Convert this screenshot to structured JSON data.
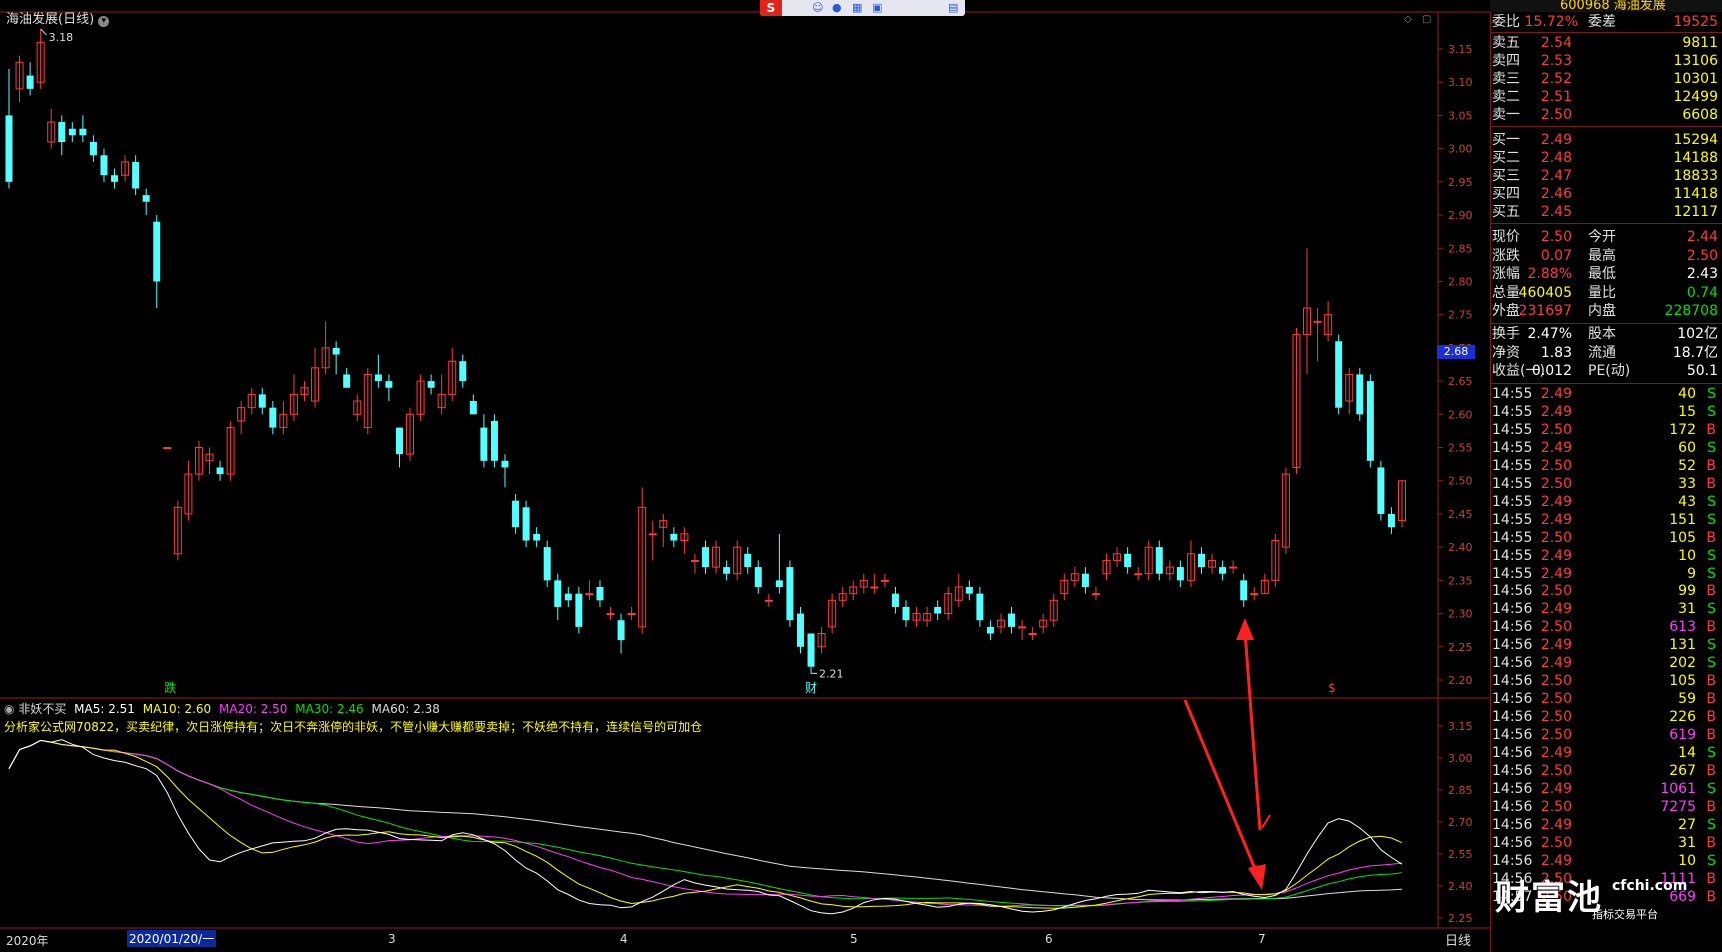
{
  "stock": {
    "title": "海油发展(日线)",
    "code": "600968",
    "name": "海油发展",
    "current_price_tag": "2.68",
    "period_button": "日线"
  },
  "indicator": {
    "name": "非妖不买",
    "ma5": "MA5: 2.51",
    "ma10": "MA10: 2.60",
    "ma20": "MA20: 2.50",
    "ma30": "MA30: 2.46",
    "ma60": "MA60: 2.38",
    "note": "分析家公式网70822，买卖纪律，次日涨停持有；次日不奔涨停的非妖，不管小赚大赚都要卖掉；不妖绝不持有，连续信号的可加仓"
  },
  "markers": {
    "high": "3.18",
    "low": "2.21",
    "tag_die": "跌",
    "tag_cai": "财",
    "tag_dollar": "$"
  },
  "x_axis": {
    "year": "2020年",
    "selected_date": "2020/01/20/一",
    "months": [
      "3",
      "4",
      "5",
      "6",
      "7"
    ]
  },
  "price_axis": [
    "3.15",
    "3.10",
    "3.05",
    "3.00",
    "2.95",
    "2.90",
    "2.85",
    "2.80",
    "2.75",
    "2.70",
    "2.65",
    "2.60",
    "2.55",
    "2.50",
    "2.45",
    "2.40",
    "2.35",
    "2.30",
    "2.25",
    "2.20"
  ],
  "indicator_axis": [
    "3.15",
    "3.00",
    "2.85",
    "2.70",
    "2.55",
    "2.40",
    "2.25"
  ],
  "order_book": {
    "weibi": {
      "label": "委比",
      "value": "15.72%",
      "label2": "委差",
      "value2": "19525"
    },
    "asks": [
      {
        "label": "卖五",
        "price": "2.54",
        "vol": "9811"
      },
      {
        "label": "卖四",
        "price": "2.53",
        "vol": "13106"
      },
      {
        "label": "卖三",
        "price": "2.52",
        "vol": "10301"
      },
      {
        "label": "卖二",
        "price": "2.51",
        "vol": "12499"
      },
      {
        "label": "卖一",
        "price": "2.50",
        "vol": "6608"
      }
    ],
    "bids": [
      {
        "label": "买一",
        "price": "2.49",
        "vol": "15294"
      },
      {
        "label": "买二",
        "price": "2.48",
        "vol": "14188"
      },
      {
        "label": "买三",
        "price": "2.47",
        "vol": "18833"
      },
      {
        "label": "买四",
        "price": "2.46",
        "vol": "11418"
      },
      {
        "label": "买五",
        "price": "2.45",
        "vol": "12117"
      }
    ]
  },
  "quote": [
    {
      "l1": "现价",
      "v1": "2.50",
      "l2": "今开",
      "v2": "2.44"
    },
    {
      "l1": "涨跌",
      "v1": "0.07",
      "l2": "最高",
      "v2": "2.50"
    },
    {
      "l1": "涨幅",
      "v1": "2.88%",
      "l2": "最低",
      "v2": "2.43"
    },
    {
      "l1": "总量",
      "v1": "460405",
      "l2": "量比",
      "v2": "0.74"
    },
    {
      "l1": "外盘",
      "v1": "231697",
      "l2": "内盘",
      "v2": "228708"
    }
  ],
  "fundamentals": [
    {
      "l1": "换手",
      "v1": "2.47%",
      "l2": "股本",
      "v2": "102亿"
    },
    {
      "l1": "净资",
      "v1": "1.83",
      "l2": "流通",
      "v2": "18.7亿"
    },
    {
      "l1": "收益(一)",
      "v1": "0.012",
      "l2": "PE(动)",
      "v2": "50.1"
    }
  ],
  "ticks": [
    {
      "t": "14:55",
      "p": "2.49",
      "v": "40",
      "s": "S"
    },
    {
      "t": "14:55",
      "p": "2.49",
      "v": "15",
      "s": "S"
    },
    {
      "t": "14:55",
      "p": "2.50",
      "v": "172",
      "s": "B"
    },
    {
      "t": "14:55",
      "p": "2.49",
      "v": "60",
      "s": "S"
    },
    {
      "t": "14:55",
      "p": "2.50",
      "v": "52",
      "s": "B"
    },
    {
      "t": "14:55",
      "p": "2.50",
      "v": "33",
      "s": "B"
    },
    {
      "t": "14:55",
      "p": "2.49",
      "v": "43",
      "s": "S"
    },
    {
      "t": "14:55",
      "p": "2.49",
      "v": "151",
      "s": "S"
    },
    {
      "t": "14:55",
      "p": "2.50",
      "v": "105",
      "s": "B"
    },
    {
      "t": "14:55",
      "p": "2.49",
      "v": "10",
      "s": "S"
    },
    {
      "t": "14:55",
      "p": "2.49",
      "v": "9",
      "s": "S"
    },
    {
      "t": "14:56",
      "p": "2.50",
      "v": "99",
      "s": "B"
    },
    {
      "t": "14:56",
      "p": "2.49",
      "v": "31",
      "s": "S"
    },
    {
      "t": "14:56",
      "p": "2.50",
      "v": "613",
      "s": "B"
    },
    {
      "t": "14:56",
      "p": "2.49",
      "v": "131",
      "s": "S"
    },
    {
      "t": "14:56",
      "p": "2.49",
      "v": "202",
      "s": "S"
    },
    {
      "t": "14:56",
      "p": "2.50",
      "v": "105",
      "s": "B"
    },
    {
      "t": "14:56",
      "p": "2.50",
      "v": "59",
      "s": "B"
    },
    {
      "t": "14:56",
      "p": "2.50",
      "v": "226",
      "s": "B"
    },
    {
      "t": "14:56",
      "p": "2.50",
      "v": "619",
      "s": "B"
    },
    {
      "t": "14:56",
      "p": "2.49",
      "v": "14",
      "s": "S"
    },
    {
      "t": "14:56",
      "p": "2.50",
      "v": "267",
      "s": "B"
    },
    {
      "t": "14:56",
      "p": "2.49",
      "v": "1061",
      "s": "S"
    },
    {
      "t": "14:56",
      "p": "2.50",
      "v": "7275",
      "s": "B"
    },
    {
      "t": "14:56",
      "p": "2.49",
      "v": "27",
      "s": "S"
    },
    {
      "t": "14:56",
      "p": "2.50",
      "v": "31",
      "s": "B"
    },
    {
      "t": "14:56",
      "p": "2.49",
      "v": "10",
      "s": "S"
    },
    {
      "t": "14:56",
      "p": "2.50",
      "v": "1111",
      "s": "B"
    },
    {
      "t": "14:57",
      "p": "2.50",
      "v": "669",
      "s": "B"
    }
  ],
  "watermark": {
    "main": "财富池",
    "site": "cfchi.com",
    "sub": "指标交易平台"
  },
  "colors": {
    "up": "#ff3b3b",
    "down": "#54ffff",
    "ma5": "#ffffff",
    "ma10": "#ffff00",
    "ma20": "#ff3cff",
    "ma30": "#00e400",
    "ma60": "#dddddd",
    "arrow": "#ff2020"
  },
  "candles": [
    [
      3.05,
      2.95,
      3.12,
      2.94
    ],
    [
      3.09,
      3.13,
      3.14,
      3.07
    ],
    [
      3.11,
      3.09,
      3.13,
      3.08
    ],
    [
      3.1,
      3.16,
      3.18,
      3.09
    ],
    [
      3.01,
      3.04,
      3.06,
      3.0
    ],
    [
      3.04,
      3.01,
      3.05,
      2.99
    ],
    [
      3.03,
      3.02,
      3.04,
      3.01
    ],
    [
      3.03,
      3.02,
      3.05,
      3.01
    ],
    [
      3.01,
      2.99,
      3.02,
      2.98
    ],
    [
      2.99,
      2.96,
      3.0,
      2.95
    ],
    [
      2.96,
      2.95,
      2.97,
      2.94
    ],
    [
      2.96,
      2.98,
      2.99,
      2.95
    ],
    [
      2.98,
      2.94,
      2.99,
      2.93
    ],
    [
      2.93,
      2.92,
      2.94,
      2.9
    ],
    [
      2.89,
      2.8,
      2.9,
      2.76
    ],
    [
      2.55,
      2.55,
      2.55,
      2.55
    ],
    [
      2.39,
      2.46,
      2.47,
      2.38
    ],
    [
      2.45,
      2.51,
      2.53,
      2.44
    ],
    [
      2.51,
      2.55,
      2.56,
      2.5
    ],
    [
      2.53,
      2.54,
      2.55,
      2.51
    ],
    [
      2.52,
      2.51,
      2.53,
      2.5
    ],
    [
      2.51,
      2.58,
      2.59,
      2.5
    ],
    [
      2.59,
      2.61,
      2.62,
      2.57
    ],
    [
      2.61,
      2.63,
      2.64,
      2.6
    ],
    [
      2.63,
      2.61,
      2.64,
      2.6
    ],
    [
      2.61,
      2.58,
      2.62,
      2.57
    ],
    [
      2.58,
      2.6,
      2.62,
      2.57
    ],
    [
      2.6,
      2.63,
      2.66,
      2.59
    ],
    [
      2.63,
      2.64,
      2.65,
      2.62
    ],
    [
      2.62,
      2.67,
      2.7,
      2.61
    ],
    [
      2.67,
      2.7,
      2.74,
      2.66
    ],
    [
      2.7,
      2.69,
      2.71,
      2.66
    ],
    [
      2.66,
      2.64,
      2.67,
      2.64
    ],
    [
      2.6,
      2.62,
      2.63,
      2.59
    ],
    [
      2.58,
      2.66,
      2.67,
      2.57
    ],
    [
      2.66,
      2.65,
      2.69,
      2.64
    ],
    [
      2.65,
      2.64,
      2.66,
      2.62
    ],
    [
      2.58,
      2.54,
      2.58,
      2.52
    ],
    [
      2.54,
      2.6,
      2.61,
      2.53
    ],
    [
      2.6,
      2.65,
      2.66,
      2.59
    ],
    [
      2.65,
      2.64,
      2.66,
      2.63
    ],
    [
      2.61,
      2.63,
      2.66,
      2.6
    ],
    [
      2.63,
      2.68,
      2.7,
      2.62
    ],
    [
      2.68,
      2.65,
      2.69,
      2.64
    ],
    [
      2.62,
      2.6,
      2.63,
      2.6
    ],
    [
      2.58,
      2.53,
      2.6,
      2.52
    ],
    [
      2.59,
      2.53,
      2.6,
      2.52
    ],
    [
      2.53,
      2.52,
      2.54,
      2.49
    ],
    [
      2.47,
      2.43,
      2.48,
      2.42
    ],
    [
      2.46,
      2.41,
      2.47,
      2.4
    ],
    [
      2.42,
      2.41,
      2.43,
      2.4
    ],
    [
      2.4,
      2.35,
      2.41,
      2.34
    ],
    [
      2.35,
      2.31,
      2.36,
      2.29
    ],
    [
      2.33,
      2.32,
      2.34,
      2.31
    ],
    [
      2.33,
      2.28,
      2.34,
      2.27
    ],
    [
      2.33,
      2.33,
      2.35,
      2.32
    ],
    [
      2.34,
      2.32,
      2.35,
      2.31
    ],
    [
      2.3,
      2.3,
      2.31,
      2.29
    ],
    [
      2.29,
      2.26,
      2.3,
      2.24
    ],
    [
      2.3,
      2.3,
      2.31,
      2.29
    ],
    [
      2.28,
      2.46,
      2.49,
      2.27
    ],
    [
      2.42,
      2.42,
      2.44,
      2.38
    ],
    [
      2.43,
      2.44,
      2.45,
      2.4
    ],
    [
      2.42,
      2.41,
      2.43,
      2.4
    ],
    [
      2.41,
      2.42,
      2.43,
      2.39
    ],
    [
      2.38,
      2.38,
      2.39,
      2.36
    ],
    [
      2.4,
      2.37,
      2.41,
      2.36
    ],
    [
      2.37,
      2.4,
      2.41,
      2.36
    ],
    [
      2.37,
      2.36,
      2.38,
      2.35
    ],
    [
      2.36,
      2.4,
      2.41,
      2.35
    ],
    [
      2.39,
      2.37,
      2.4,
      2.36
    ],
    [
      2.37,
      2.34,
      2.38,
      2.33
    ],
    [
      2.32,
      2.32,
      2.33,
      2.31
    ],
    [
      2.35,
      2.34,
      2.42,
      2.33
    ],
    [
      2.37,
      2.29,
      2.38,
      2.28
    ],
    [
      2.3,
      2.25,
      2.31,
      2.24
    ],
    [
      2.27,
      2.22,
      2.27,
      2.21
    ],
    [
      2.25,
      2.27,
      2.28,
      2.24
    ],
    [
      2.28,
      2.32,
      2.33,
      2.27
    ],
    [
      2.32,
      2.33,
      2.34,
      2.31
    ],
    [
      2.33,
      2.34,
      2.35,
      2.32
    ],
    [
      2.34,
      2.35,
      2.36,
      2.33
    ],
    [
      2.34,
      2.34,
      2.36,
      2.33
    ],
    [
      2.35,
      2.35,
      2.36,
      2.34
    ],
    [
      2.33,
      2.31,
      2.34,
      2.3
    ],
    [
      2.31,
      2.29,
      2.32,
      2.28
    ],
    [
      2.29,
      2.3,
      2.31,
      2.28
    ],
    [
      2.29,
      2.3,
      2.31,
      2.28
    ],
    [
      2.31,
      2.3,
      2.32,
      2.29
    ],
    [
      2.3,
      2.33,
      2.34,
      2.29
    ],
    [
      2.32,
      2.34,
      2.36,
      2.31
    ],
    [
      2.34,
      2.33,
      2.35,
      2.32
    ],
    [
      2.33,
      2.29,
      2.34,
      2.28
    ],
    [
      2.28,
      2.27,
      2.29,
      2.26
    ],
    [
      2.28,
      2.29,
      2.3,
      2.27
    ],
    [
      2.3,
      2.28,
      2.31,
      2.27
    ],
    [
      2.28,
      2.28,
      2.29,
      2.26
    ],
    [
      2.27,
      2.27,
      2.28,
      2.26
    ],
    [
      2.28,
      2.29,
      2.3,
      2.27
    ],
    [
      2.29,
      2.32,
      2.33,
      2.28
    ],
    [
      2.33,
      2.35,
      2.36,
      2.32
    ],
    [
      2.35,
      2.36,
      2.37,
      2.34
    ],
    [
      2.36,
      2.34,
      2.37,
      2.33
    ],
    [
      2.33,
      2.33,
      2.34,
      2.32
    ],
    [
      2.36,
      2.38,
      2.39,
      2.35
    ],
    [
      2.38,
      2.39,
      2.4,
      2.37
    ],
    [
      2.39,
      2.37,
      2.4,
      2.36
    ],
    [
      2.36,
      2.36,
      2.37,
      2.35
    ],
    [
      2.36,
      2.4,
      2.41,
      2.35
    ],
    [
      2.4,
      2.36,
      2.41,
      2.35
    ],
    [
      2.36,
      2.37,
      2.38,
      2.35
    ],
    [
      2.37,
      2.35,
      2.38,
      2.34
    ],
    [
      2.35,
      2.39,
      2.41,
      2.34
    ],
    [
      2.39,
      2.37,
      2.4,
      2.36
    ],
    [
      2.37,
      2.38,
      2.39,
      2.36
    ],
    [
      2.37,
      2.36,
      2.38,
      2.35
    ],
    [
      2.37,
      2.37,
      2.38,
      2.36
    ],
    [
      2.35,
      2.32,
      2.36,
      2.31
    ],
    [
      2.33,
      2.33,
      2.34,
      2.32
    ],
    [
      2.33,
      2.35,
      2.36,
      2.33
    ],
    [
      2.35,
      2.41,
      2.42,
      2.34
    ],
    [
      2.4,
      2.51,
      2.52,
      2.39
    ],
    [
      2.52,
      2.72,
      2.73,
      2.51
    ],
    [
      2.72,
      2.76,
      2.85,
      2.66
    ],
    [
      2.74,
      2.74,
      2.76,
      2.68
    ],
    [
      2.72,
      2.75,
      2.77,
      2.71
    ],
    [
      2.71,
      2.61,
      2.72,
      2.6
    ],
    [
      2.62,
      2.66,
      2.67,
      2.6
    ],
    [
      2.66,
      2.6,
      2.67,
      2.59
    ],
    [
      2.65,
      2.53,
      2.66,
      2.52
    ],
    [
      2.52,
      2.45,
      2.53,
      2.44
    ],
    [
      2.45,
      2.43,
      2.46,
      2.42
    ],
    [
      2.44,
      2.5,
      2.5,
      2.43
    ]
  ]
}
